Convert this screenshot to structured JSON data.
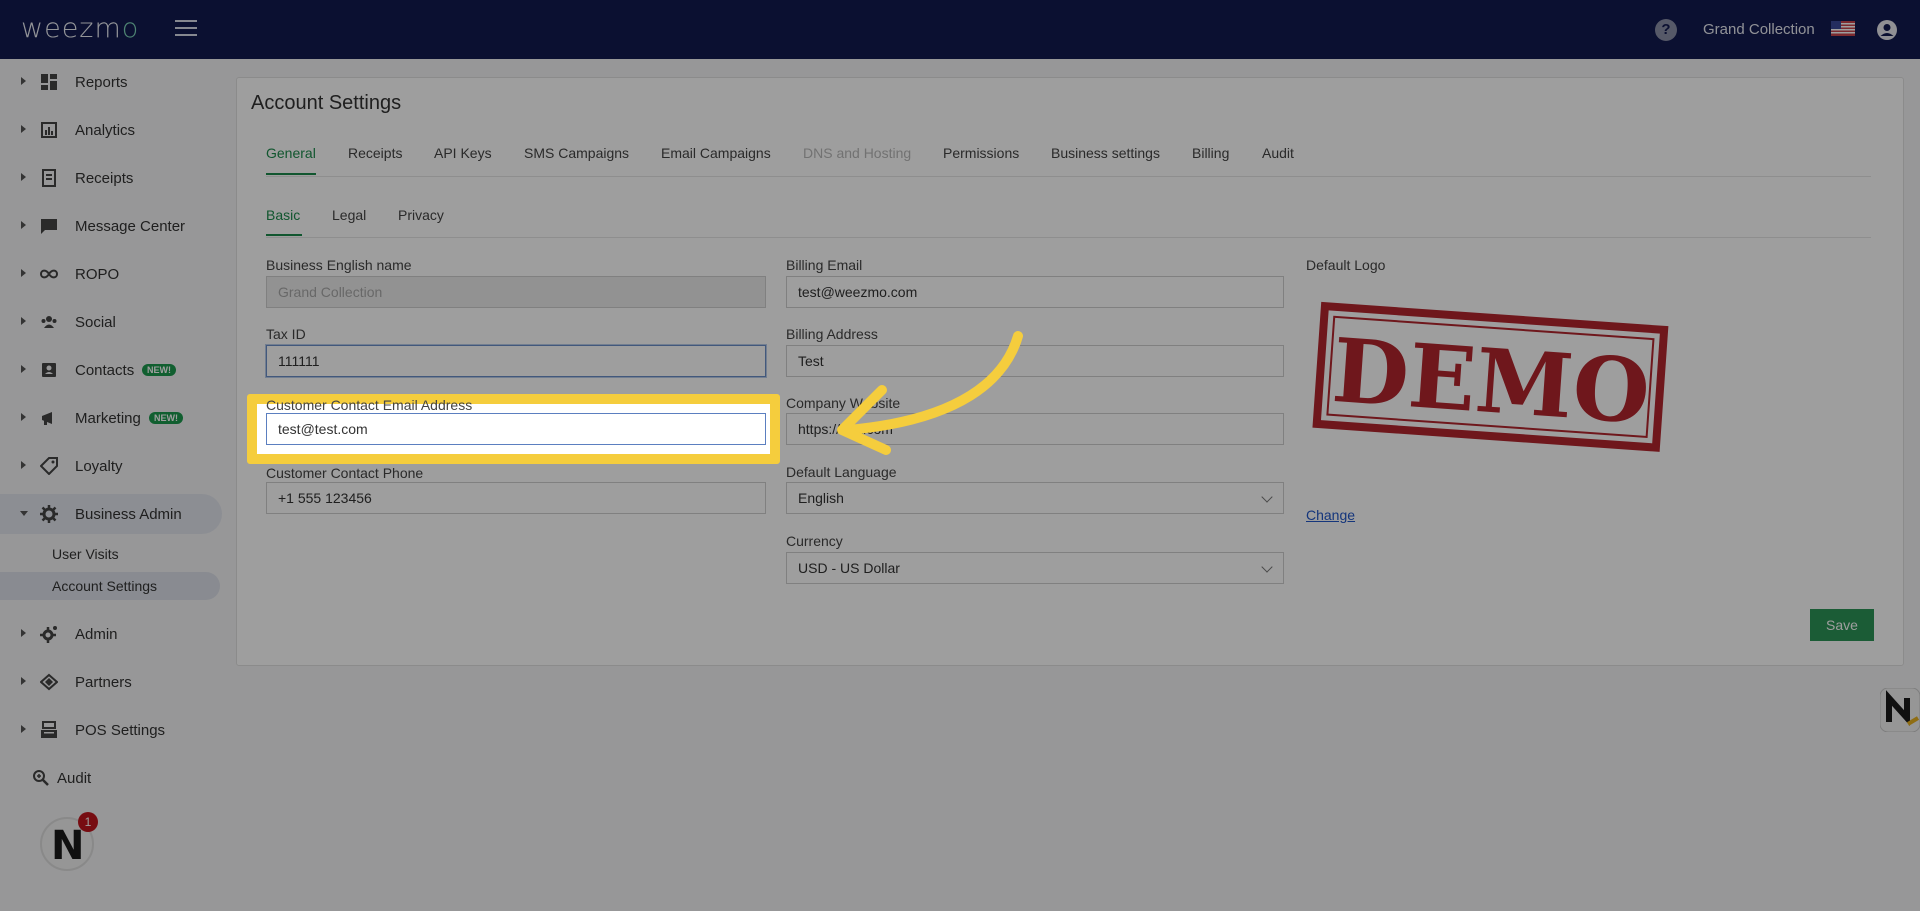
{
  "header": {
    "logo_text": "weezm",
    "logo_accent": "o",
    "org_name": "Grand Collection",
    "icons": [
      "menu-icon",
      "help-icon",
      "us-flag-icon",
      "user-account-icon"
    ]
  },
  "sidebar": {
    "items": [
      {
        "label": "Reports",
        "icon": "dashboard-icon"
      },
      {
        "label": "Analytics",
        "icon": "chart-icon"
      },
      {
        "label": "Receipts",
        "icon": "receipt-icon"
      },
      {
        "label": "Message Center",
        "icon": "message-icon"
      },
      {
        "label": "ROPO",
        "icon": "infinity-icon"
      },
      {
        "label": "Social",
        "icon": "people-icon"
      },
      {
        "label": "Contacts",
        "icon": "contacts-icon",
        "badge": "NEW!"
      },
      {
        "label": "Marketing",
        "icon": "megaphone-icon",
        "badge": "NEW!"
      },
      {
        "label": "Loyalty",
        "icon": "tag-icon"
      },
      {
        "label": "Business Admin",
        "icon": "gear-icon"
      },
      {
        "label": "Admin",
        "icon": "admin-gear-icon"
      },
      {
        "label": "Partners",
        "icon": "diamond-icon"
      },
      {
        "label": "POS Settings",
        "icon": "register-icon"
      },
      {
        "label": "Audit",
        "icon": "zoom-icon"
      }
    ],
    "sub_items": [
      {
        "label": "User Visits"
      },
      {
        "label": "Account Settings"
      }
    ],
    "notification_count": "1",
    "avatar_letter": "N"
  },
  "main": {
    "title": "Account Settings",
    "tabs": [
      {
        "label": "General"
      },
      {
        "label": "Receipts"
      },
      {
        "label": "API Keys"
      },
      {
        "label": "SMS Campaigns"
      },
      {
        "label": "Email Campaigns"
      },
      {
        "label": "DNS and Hosting"
      },
      {
        "label": "Permissions"
      },
      {
        "label": "Business settings"
      },
      {
        "label": "Billing"
      },
      {
        "label": "Audit"
      }
    ],
    "subtabs": [
      {
        "label": "Basic"
      },
      {
        "label": "Legal"
      },
      {
        "label": "Privacy"
      }
    ],
    "fields": {
      "business_name": {
        "label": "Business English name",
        "placeholder": "Grand Collection"
      },
      "tax_id": {
        "label": "Tax ID",
        "value": "111111"
      },
      "contact_email": {
        "label": "Customer Contact Email Address",
        "value": "test@test.com"
      },
      "contact_phone": {
        "label": "Customer Contact Phone",
        "value": "+1 555 123456"
      },
      "billing_email": {
        "label": "Billing Email",
        "value": "test@weezmo.com"
      },
      "billing_address": {
        "label": "Billing Address",
        "value": "Test"
      },
      "company_website": {
        "label": "Company Website",
        "value": "https://test.com"
      },
      "default_language": {
        "label": "Default Language",
        "value": "English"
      },
      "currency": {
        "label": "Currency",
        "value": "USD - US Dollar"
      }
    },
    "logo": {
      "label": "Default Logo",
      "stamp_text": "DEMO",
      "change_label": "Change"
    },
    "save_label": "Save"
  },
  "colors": {
    "topbar": "#121a50",
    "accent_green": "#1c8c4c",
    "highlight_yellow": "#f5cd3d",
    "stamp_red": "#b3262e"
  }
}
